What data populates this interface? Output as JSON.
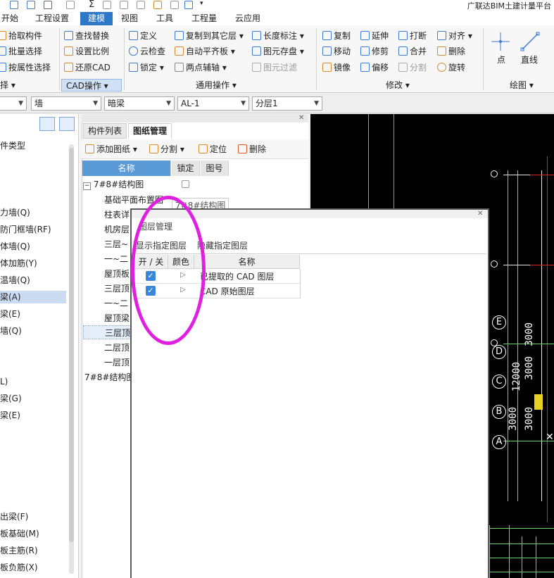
{
  "app": {
    "title": "广联达BIM土建计量平台"
  },
  "tabs": [
    "开始",
    "工程设置",
    "建模",
    "视图",
    "工具",
    "工程量",
    "云应用"
  ],
  "active_tab": "建模",
  "ribbon": {
    "select_group": {
      "items": [
        "拾取构件",
        "批量选择",
        "按属性选择"
      ],
      "label": "择"
    },
    "cad_group": {
      "items": [
        "查找替换",
        "设置比例",
        "还原CAD"
      ],
      "label": "CAD操作"
    },
    "common_group": {
      "col1": [
        "定义",
        "云检查",
        "锁定"
      ],
      "col2": [
        "复制到其它层",
        "自动平齐板",
        "两点辅轴"
      ],
      "col3": [
        "长度标注",
        "图元存盘",
        "图元过滤"
      ],
      "label": "通用操作"
    },
    "modify_group": {
      "col1": [
        "复制",
        "移动",
        "镜像"
      ],
      "col2": [
        "延伸",
        "修剪",
        "偏移"
      ],
      "col3": [
        "打断",
        "合并",
        "分割"
      ],
      "col4": [
        "对齐",
        "删除",
        "旋转"
      ],
      "label": "修改"
    },
    "draw_group": {
      "items": [
        "点",
        "直线"
      ],
      "label": "绘图"
    }
  },
  "toolbar": {
    "dropdowns": [
      "",
      "墙",
      "暗梁",
      "AL-1",
      "分层1"
    ]
  },
  "left_panel": {
    "header": "件类型",
    "items": [
      "力墙(Q)",
      "防门框墙(RF)",
      "体墙(Q)",
      "体加筋(Y)",
      "温墙(Q)",
      "梁(A)",
      "梁(E)",
      "墙(Q)",
      "L)",
      "梁(G)",
      "梁(E)",
      "出梁(F)",
      "板基础(M)",
      "板主筋(R)",
      "板负筋(X)"
    ],
    "selected": "梁(A)"
  },
  "mid_panel": {
    "tabs": [
      "构件列表",
      "图纸管理"
    ],
    "active_tab": "图纸管理",
    "tools": [
      "添加图纸",
      "分割",
      "定位",
      "删除"
    ],
    "columns": [
      "名称",
      "锁定",
      "图号"
    ],
    "root": "7#8#结构图",
    "rows": [
      "基础平面布置图",
      "柱表详",
      "机房层",
      "三层~",
      "一~二",
      "屋顶板",
      "三层顶",
      "一~二",
      "屋顶梁",
      "三层顶",
      "二层顶",
      "一层顶"
    ],
    "footer": "7#8#结构图",
    "tooltip": "7#8#结构图"
  },
  "layer_dialog": {
    "title": "图层管理",
    "buttons": [
      "显示指定图层",
      "隐藏指定图层"
    ],
    "columns": [
      "开 / 关",
      "颜色",
      "名称"
    ],
    "rows": [
      {
        "on": true,
        "name": "已提取的 CAD 图层"
      },
      {
        "on": true,
        "name": "CAD 原始图层"
      }
    ]
  },
  "cad": {
    "axes": [
      "E",
      "D",
      "C",
      "B",
      "A"
    ],
    "dims": [
      "3000",
      "3000",
      "3000",
      "3000",
      "12000"
    ]
  }
}
